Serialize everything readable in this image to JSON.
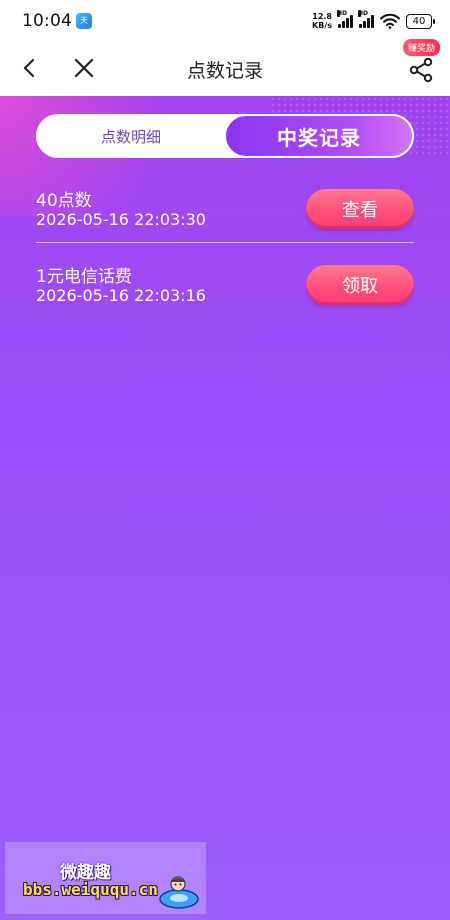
{
  "status_bar": {
    "time": "10:04",
    "app_icon_text": "天",
    "net_speed_value": "12.8",
    "net_speed_unit": "KB/s",
    "signal_label_1": "HD",
    "signal_label_2": "HD",
    "battery": "40"
  },
  "nav": {
    "title": "点数记录",
    "badge": "赚奖励"
  },
  "tabs": {
    "detail_label": "点数明细",
    "winning_label": "中奖记录",
    "active": "winning"
  },
  "records": [
    {
      "name": "40点数",
      "time": "2026-05-16 22:03:30",
      "button": "查看"
    },
    {
      "name": "1元电信话费",
      "time": "2026-05-16 22:03:16",
      "button": "领取"
    }
  ],
  "watermark": {
    "title": "微趣趣",
    "url": "bbs.weiququ.cn"
  }
}
